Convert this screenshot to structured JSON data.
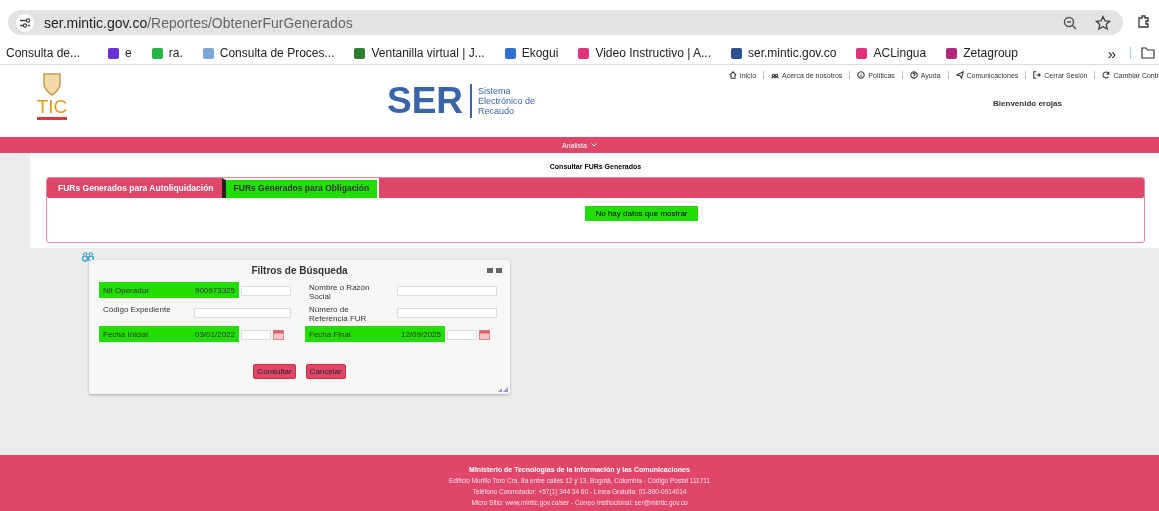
{
  "browser": {
    "url_host": "ser.mintic.gov.co",
    "url_path": "/Reportes/ObtenerFurGenerados",
    "bookmarks": [
      {
        "label": "Consulta de...",
        "kind": "none"
      },
      {
        "label": "e",
        "kind": "mail"
      },
      {
        "label": "ra.",
        "kind": "chat"
      },
      {
        "label": "Consulta de Proces...",
        "kind": "doc"
      },
      {
        "label": "Ventanilla virtual | J...",
        "kind": "diamond"
      },
      {
        "label": "Ekogui",
        "kind": "globe"
      },
      {
        "label": "Video Instructivo | A...",
        "kind": "ac"
      },
      {
        "label": "ser.mintic.gov.co",
        "kind": "ser"
      },
      {
        "label": "ACLingua",
        "kind": "ac"
      },
      {
        "label": "Zetagroup",
        "kind": "zeta"
      }
    ],
    "more": "»"
  },
  "header": {
    "logo": "TIC",
    "brand": "SER",
    "brand_sub": "Sistema Electrónico de Recaudo",
    "welcome": "Bienvenido erojas",
    "nav": [
      {
        "label": "Inicio"
      },
      {
        "label": "Acerca de nosotros"
      },
      {
        "label": "Políticas"
      },
      {
        "label": "Ayuda"
      },
      {
        "label": "Comunicaciones"
      },
      {
        "label": "Cerrar Sesión"
      },
      {
        "label": "Cambiar Contr"
      }
    ]
  },
  "menu": {
    "label": "Analista"
  },
  "panel": {
    "title": "Consultar FURs Generados",
    "tabs": [
      {
        "label": "FURs Generados para Autoliquidación",
        "selected": false
      },
      {
        "label": "FURs Generados para Obligación",
        "selected": true
      }
    ],
    "empty_message": "No hay datos que mostrar"
  },
  "dialog": {
    "title": "Filtros de Búsqueda",
    "fields": [
      {
        "label": "Nit Operador",
        "value": "900973325",
        "highlighted": true,
        "kind": "text"
      },
      {
        "label": "Nombre o Razón Social",
        "highlighted": false,
        "kind": "text"
      },
      {
        "label": "Código Expediente",
        "highlighted": false,
        "kind": "text"
      },
      {
        "label": "Número de Referencia FUR",
        "highlighted": false,
        "kind": "text"
      },
      {
        "label": "Fecha Inicial",
        "value": "03/01/2022",
        "highlighted": true,
        "kind": "date"
      },
      {
        "label": "Fecha Final",
        "value": "12/09/2025",
        "highlighted": true,
        "kind": "date"
      }
    ],
    "buttons": [
      "Consultar",
      "Cancelar"
    ]
  },
  "footer": {
    "title": "Ministerio de Tecnologías de la Información y las Comunicaciones",
    "lines": [
      "Edificio Murillo Toro Cra. 8a entre calles 12 y 13, Bogotá, Colombia - Código Postal 111711",
      "Teléfono Conmutador: +57(1) 344 34 60 - Línea Gratuita: 01-800-0914014",
      "Micro Sitio: www.mintic.gov.co/ser - Correo Institucional: ser@mintic.gov.co"
    ]
  }
}
